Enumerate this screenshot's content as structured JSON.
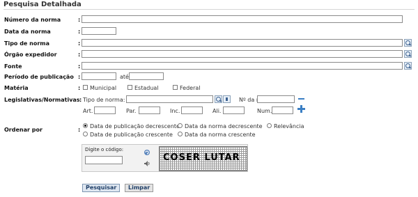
{
  "title": "Pesquisa Detalhada",
  "fields": {
    "numero": "Número da norma",
    "data": "Data da norma",
    "tipo": "Tipo de norma",
    "orgao": "Órgão expedidor",
    "fonte": "Fonte",
    "periodo": "Período de publicação",
    "periodo_ate": "até",
    "materia": "Matéria",
    "legislativas": "Legislativas/Normativas",
    "ordenar": "Ordenar por"
  },
  "colon": ":",
  "materia_options": [
    "Municipal",
    "Estadual",
    "Federal"
  ],
  "leg": {
    "tipo_label": "Tipo de norma:",
    "nro_label": "Nº da norma:",
    "art": "Art.",
    "par": "Par.",
    "inc": "Inc.",
    "ali": "Ali.",
    "num": "Num."
  },
  "ordenar_options": [
    "Data de publicação decrescente",
    "Data da norma decrescente",
    "Relevância",
    "Data de publicação crescente",
    "Data da norma crescente"
  ],
  "ordenar_selected": 0,
  "captcha": {
    "prompt": "Digite o código:",
    "code": "COSER LUTAR"
  },
  "buttons": {
    "search": "Pesquisar",
    "clear": "Limpar"
  },
  "colors": {
    "accent": "#3a5f8f",
    "plus": "#3b7fc4",
    "button_bg": "#dfe7f1"
  }
}
